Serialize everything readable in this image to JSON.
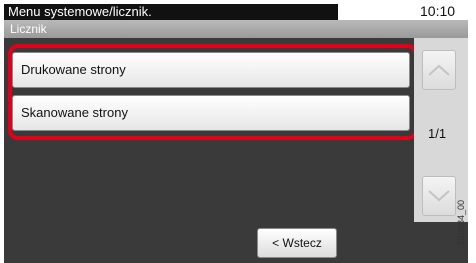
{
  "header": {
    "title": "Menu systemowe/licznik.",
    "time": "10:10",
    "subtitle": "Licznik"
  },
  "list": {
    "items": [
      {
        "label": "Drukowane strony"
      },
      {
        "label": "Skanowane strony"
      }
    ],
    "highlight_color": "#e0001a"
  },
  "pagination": {
    "page_indicator": "1/1",
    "up_icon": "chevron-up-icon",
    "down_icon": "chevron-down-icon"
  },
  "footer": {
    "back_label": "< Wstecz",
    "back_icon": "chevron-left"
  },
  "image_code": "3B0584_00",
  "colors": {
    "title_bg": "#111111",
    "panel_bg": "#3a3a3a",
    "scroll_bg": "#d8d8d8"
  }
}
